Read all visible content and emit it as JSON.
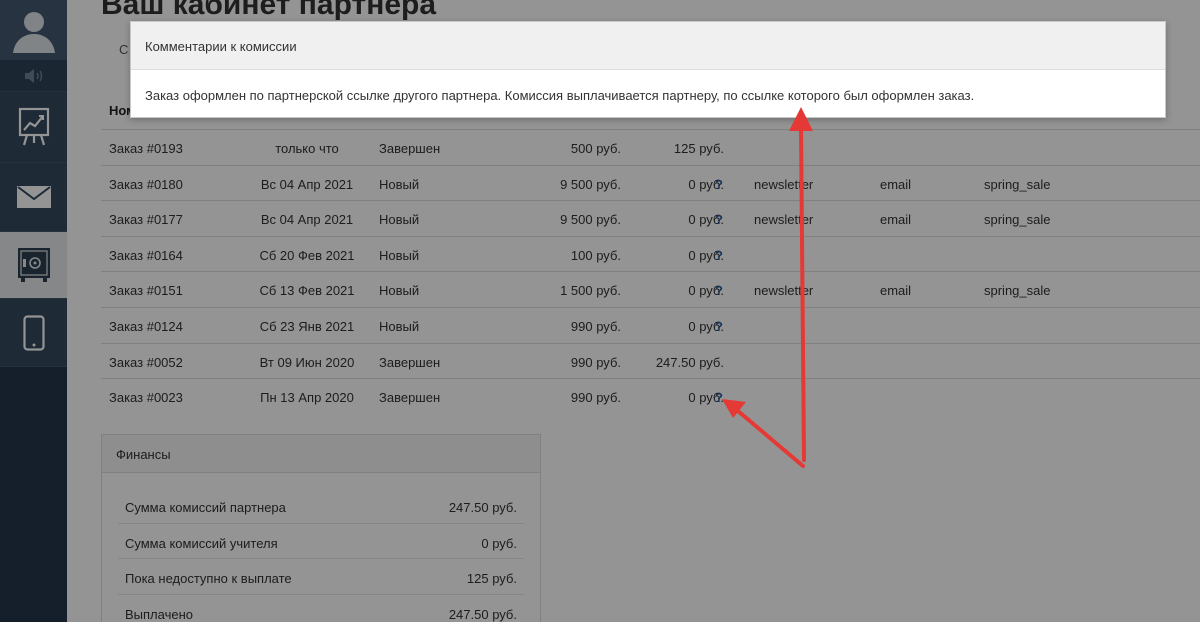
{
  "page": {
    "title": "Ваш кабинет партнера",
    "tab_peek": "С",
    "col_peek": "Ном"
  },
  "sidebar": {
    "items": [
      {
        "icon": "user-icon"
      },
      {
        "icon": "speaker-icon"
      },
      {
        "icon": "chart-board-icon"
      },
      {
        "icon": "mail-icon"
      },
      {
        "icon": "safe-icon",
        "active": true
      },
      {
        "icon": "phone-icon"
      }
    ]
  },
  "orders": [
    {
      "num": "Заказ #0193",
      "date": "только что",
      "status": "Завершен",
      "sum": "500 руб.",
      "commission": "125 руб.",
      "q": "",
      "source": "",
      "medium": "",
      "campaign": ""
    },
    {
      "num": "Заказ #0180",
      "date": "Вс 04 Апр 2021",
      "status": "Новый",
      "sum": "9 500 руб.",
      "commission": "0 руб.",
      "q": "?",
      "source": "newsletter",
      "medium": "email",
      "campaign": "spring_sale"
    },
    {
      "num": "Заказ #0177",
      "date": "Вс 04 Апр 2021",
      "status": "Новый",
      "sum": "9 500 руб.",
      "commission": "0 руб.",
      "q": "?",
      "source": "newsletter",
      "medium": "email",
      "campaign": "spring_sale"
    },
    {
      "num": "Заказ #0164",
      "date": "Сб 20 Фев 2021",
      "status": "Новый",
      "sum": "100 руб.",
      "commission": "0 руб.",
      "q": "?",
      "source": "",
      "medium": "",
      "campaign": ""
    },
    {
      "num": "Заказ #0151",
      "date": "Сб 13 Фев 2021",
      "status": "Новый",
      "sum": "1 500 руб.",
      "commission": "0 руб.",
      "q": "?",
      "source": "newsletter",
      "medium": "email",
      "campaign": "spring_sale"
    },
    {
      "num": "Заказ #0124",
      "date": "Сб 23 Янв 2021",
      "status": "Новый",
      "sum": "990 руб.",
      "commission": "0 руб.",
      "q": "?",
      "source": "",
      "medium": "",
      "campaign": ""
    },
    {
      "num": "Заказ #0052",
      "date": "Вт 09 Июн 2020",
      "status": "Завершен",
      "sum": "990 руб.",
      "commission": "247.50 руб.",
      "q": "",
      "source": "",
      "medium": "",
      "campaign": ""
    },
    {
      "num": "Заказ #0023",
      "date": "Пн 13 Апр 2020",
      "status": "Завершен",
      "sum": "990 руб.",
      "commission": "0 руб.",
      "q": "?",
      "source": "",
      "medium": "",
      "campaign": ""
    }
  ],
  "finance": {
    "title": "Финансы",
    "rows": [
      {
        "label": "Сумма комиссий партнера",
        "value": "247.50 руб."
      },
      {
        "label": "Сумма комиссий учителя",
        "value": "0 руб."
      },
      {
        "label": "Пока недоступно к выплате",
        "value": "125 руб."
      },
      {
        "label": "Выплачено",
        "value": "247.50 руб."
      }
    ]
  },
  "modal": {
    "title": "Комментарии к комиссии",
    "body": "Заказ оформлен по партнерской ссылке другого партнера. Комиссия выплачивается партнеру, по ссылке которого был оформлен заказ."
  },
  "colors": {
    "sidebar": "#34495e",
    "arrow": "#e53935",
    "question": "#2a5d9e"
  }
}
